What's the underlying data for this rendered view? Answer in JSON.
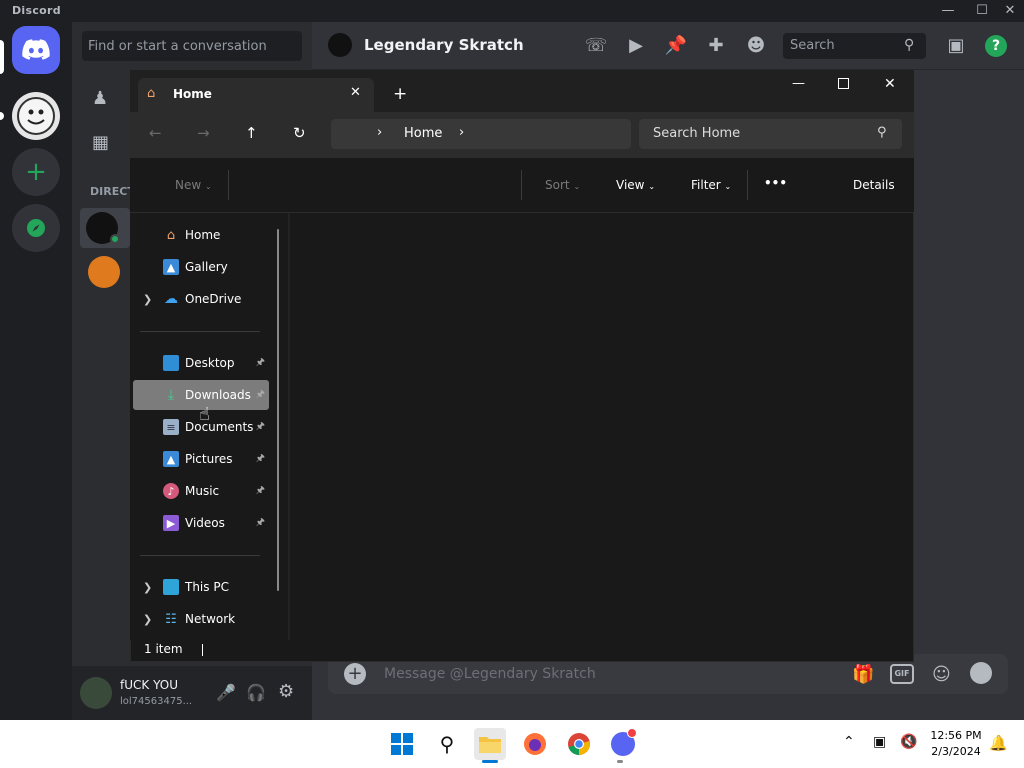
{
  "discord": {
    "app_name": "Discord",
    "dm_search_placeholder": "Find or start a conversation",
    "channel_section_label": "DIRECT",
    "chat_title": "Legendary Skratch",
    "header_search_placeholder": "Search",
    "message_placeholder": "Message @Legendary Skratch",
    "user": {
      "display_name": "fUCK YOU",
      "tag": "lol74563475..."
    },
    "accent_color": "#5865f2",
    "online_color": "#23a55a"
  },
  "explorer": {
    "tab_title": "Home",
    "breadcrumb": "Home",
    "search_placeholder": "Search Home",
    "toolbar": {
      "new_label": "New",
      "sort_label": "Sort",
      "view_label": "View",
      "filter_label": "Filter",
      "more_label": "•••",
      "details_label": "Details"
    },
    "nav": {
      "quick": [
        {
          "label": "Home",
          "icon": "home-icon"
        },
        {
          "label": "Gallery",
          "icon": "gallery-icon"
        },
        {
          "label": "OneDrive",
          "icon": "cloud-icon"
        }
      ],
      "pinned": [
        {
          "label": "Desktop",
          "icon": "desktop-icon"
        },
        {
          "label": "Downloads",
          "icon": "download-icon"
        },
        {
          "label": "Documents",
          "icon": "document-icon"
        },
        {
          "label": "Pictures",
          "icon": "picture-icon"
        },
        {
          "label": "Music",
          "icon": "music-icon"
        },
        {
          "label": "Videos",
          "icon": "video-icon"
        }
      ],
      "devices": [
        {
          "label": "This PC",
          "icon": "pc-icon"
        },
        {
          "label": "Network",
          "icon": "network-icon"
        }
      ]
    },
    "status": "1 item"
  },
  "taskbar": {
    "time": "12:56 PM",
    "date": "2/3/2024"
  }
}
